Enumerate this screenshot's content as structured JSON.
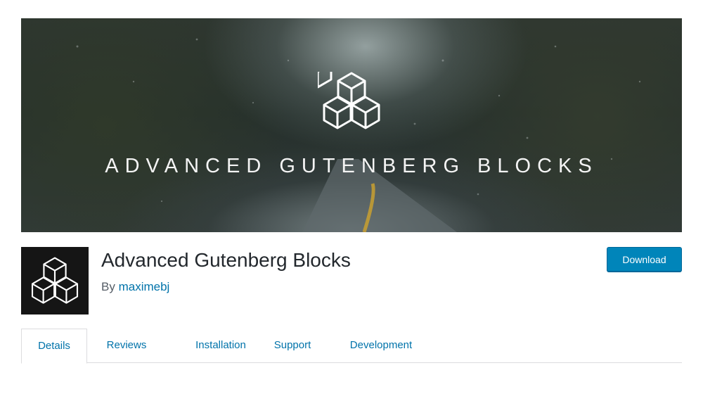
{
  "banner": {
    "title": "ADVANCED GUTENBERG BLOCKS",
    "logo_icon": "cubes-icon"
  },
  "plugin": {
    "icon": "cubes-icon",
    "name": "Advanced Gutenberg Blocks",
    "by_label": "By",
    "author": "maximebj"
  },
  "actions": {
    "download_label": "Download"
  },
  "tabs": [
    {
      "label": "Details",
      "active": true
    },
    {
      "label": "Reviews",
      "active": false
    },
    {
      "label": "Installation",
      "active": false
    },
    {
      "label": "Support",
      "active": false
    },
    {
      "label": "Development",
      "active": false
    }
  ],
  "colors": {
    "link": "#0073aa",
    "button": "#0085ba"
  }
}
